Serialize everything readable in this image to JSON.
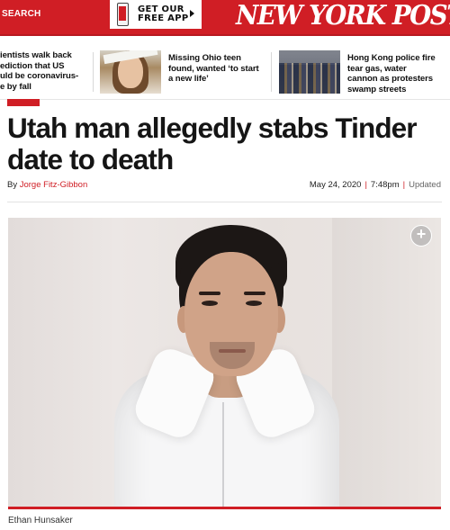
{
  "header": {
    "search_label": "SEARCH",
    "app_cta_line1": "GET OUR",
    "app_cta_line2": "FREE APP",
    "logo_text": "NEW YORK POST",
    "brand_color": "#d01e25"
  },
  "related": [
    {
      "text_lines": [
        "ientists walk back",
        "ediction that US",
        "uld be coronavirus-",
        "e by fall"
      ]
    },
    {
      "text_lines": [
        "Missing Ohio teen",
        "found, wanted ‘to start",
        "a new life’"
      ]
    },
    {
      "text_lines": [
        "Hong Kong police fire",
        "tear gas, water",
        "cannon as protesters",
        "swamp streets"
      ]
    }
  ],
  "article": {
    "title": "Utah man allegedly stabs Tinder date to death",
    "byline_prefix": "By ",
    "author": "Jorge Fitz-Gibbon",
    "date": "May 24, 2020",
    "time": "7:48pm",
    "updated": "Updated",
    "image_caption": "Ethan Hunsaker"
  },
  "icons": {
    "expand": "plus-circle-icon",
    "app": "phone-icon",
    "arrow": "play-arrow-icon"
  }
}
